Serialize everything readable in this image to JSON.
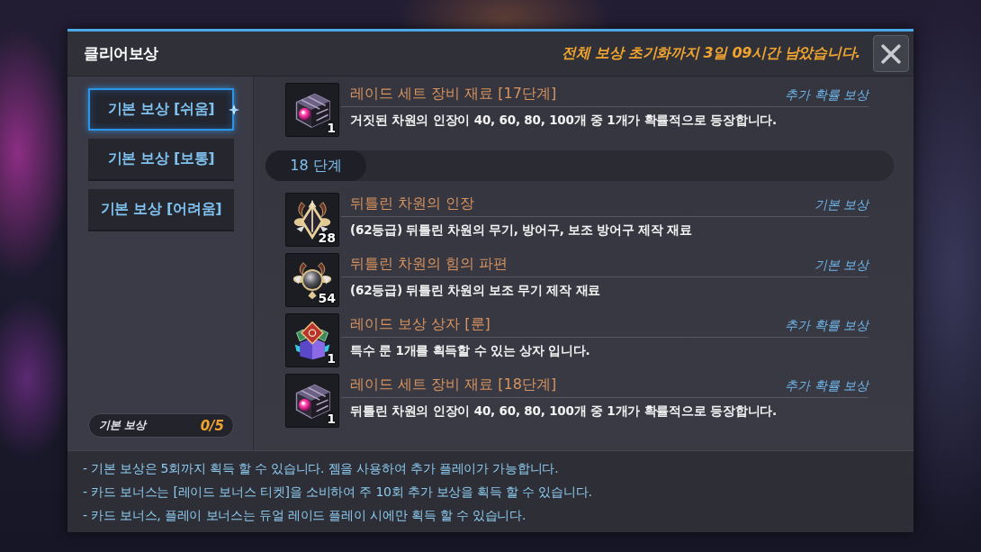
{
  "dialog": {
    "title": "클리어보상",
    "reset_notice": "전체 보상 초기화까지 3일 09시간 남았습니다."
  },
  "sidebar": {
    "tabs": [
      {
        "label": "기본 보상 [쉬움]",
        "selected": true
      },
      {
        "label": "기본 보상 [보통]",
        "selected": false
      },
      {
        "label": "기본 보상 [어려움]",
        "selected": false
      }
    ],
    "progress": {
      "label": "기본 보상",
      "count": "0/5"
    }
  },
  "reward_list": {
    "sections": [
      {
        "items": [
          {
            "kind": "set_material",
            "count": "1",
            "name": "레이드 세트 장비 재료 [17단계]",
            "tag": "추가 확률 보상",
            "description": "거짓된 차원의 인장이 40, 60, 80, 100개 중 1개가 확률적으로 등장합니다."
          }
        ]
      },
      {
        "stage": "18 단계",
        "items": [
          {
            "kind": "seal",
            "count": "28",
            "name": "뒤틀린 차원의 인장",
            "tag": "기본 보상",
            "description": "(62등급) 뒤틀린 차원의 무기, 방어구, 보조 방어구 제작 재료"
          },
          {
            "kind": "power_shard",
            "count": "54",
            "name": "뒤틀린 차원의 힘의 파편",
            "tag": "기본 보상",
            "description": "(62등급) 뒤틀린 차원의 보조 무기 제작 재료"
          },
          {
            "kind": "rune_box",
            "count": "1",
            "name": "레이드 보상 상자 [룬]",
            "tag": "추가 확률 보상",
            "description": "특수 룬 1개를 획득할 수 있는 상자 입니다."
          },
          {
            "kind": "set_material",
            "count": "1",
            "name": "레이드 세트 장비 재료 [18단계]",
            "tag": "추가 확률 보상",
            "description": "뒤틀린 차원의 인장이 40, 60, 80, 100개 중 1개가 확률적으로 등장합니다."
          }
        ]
      }
    ]
  },
  "notes": [
    "- 기본 보상은 5회까지 획득 할 수 있습니다. 젬을 사용하여 추가 플레이가 가능합니다.",
    "- 카드 보너스는 [레이드 보너스 티켓]을 소비하여 주 10회 추가 보상을 획득 할 수 있습니다.",
    "- 카드 보너스, 플레이 보너스는 듀얼 레이드 플레이 시에만 획득 할 수 있습니다."
  ]
}
